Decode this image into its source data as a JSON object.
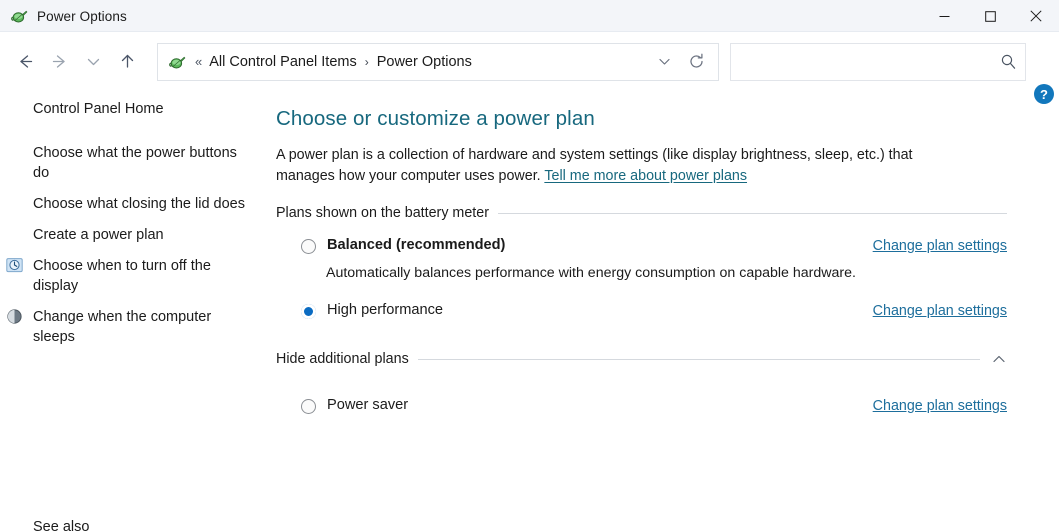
{
  "window": {
    "title": "Power Options",
    "icon": "control-panel-icon",
    "controls": {
      "minimize": "minimize-button",
      "maximize": "maximize-button",
      "close": "close-button"
    }
  },
  "nav": {
    "back": "back-button",
    "forward": "forward-button",
    "recent": "recent-locations-button",
    "up": "up-button",
    "address": {
      "icon": "control-panel-icon",
      "overflow": "«",
      "separator": "›",
      "crumbs": [
        "All Control Panel Items",
        "Power Options"
      ],
      "dropdown": "address-dropdown-button",
      "refresh": "refresh-button"
    },
    "search": {
      "value": "",
      "placeholder": "",
      "icon": "search-icon"
    }
  },
  "sidebar": {
    "home": "Control Panel Home",
    "items": [
      {
        "label": "Choose what the power buttons do",
        "icon": null
      },
      {
        "label": "Choose what closing the lid does",
        "icon": null
      },
      {
        "label": "Create a power plan",
        "icon": null
      },
      {
        "label": "Choose when to turn off the display",
        "icon": "display-timer-icon"
      },
      {
        "label": "Change when the computer sleeps",
        "icon": "sleep-moon-icon"
      }
    ],
    "see_also": "See also"
  },
  "content": {
    "help_button": "?",
    "title": "Choose or customize a power plan",
    "intro_part1": "A power plan is a collection of hardware and system settings (like display brightness, sleep, etc.) that manages how your computer uses power. ",
    "intro_link": "Tell me more about power plans",
    "groups": [
      {
        "heading": "Plans shown on the battery meter",
        "collapse_icon": null,
        "plans": [
          {
            "name": "Balanced (recommended)",
            "bold": true,
            "selected": false,
            "description": "Automatically balances performance with energy consumption on capable hardware.",
            "link": "Change plan settings"
          },
          {
            "name": "High performance",
            "bold": false,
            "selected": true,
            "description": "",
            "link": "Change plan settings"
          }
        ]
      },
      {
        "heading": "Hide additional plans",
        "collapse_icon": "chevron-up-icon",
        "plans": [
          {
            "name": "Power saver",
            "bold": false,
            "selected": false,
            "description": "",
            "link": "Change plan settings"
          }
        ]
      }
    ]
  },
  "colors": {
    "titlebar": "#f3f5f9",
    "heading": "#17687e",
    "link": "#1d6e9c",
    "radio_selected": "#0a6bc2",
    "help_badge": "#1277bc"
  }
}
